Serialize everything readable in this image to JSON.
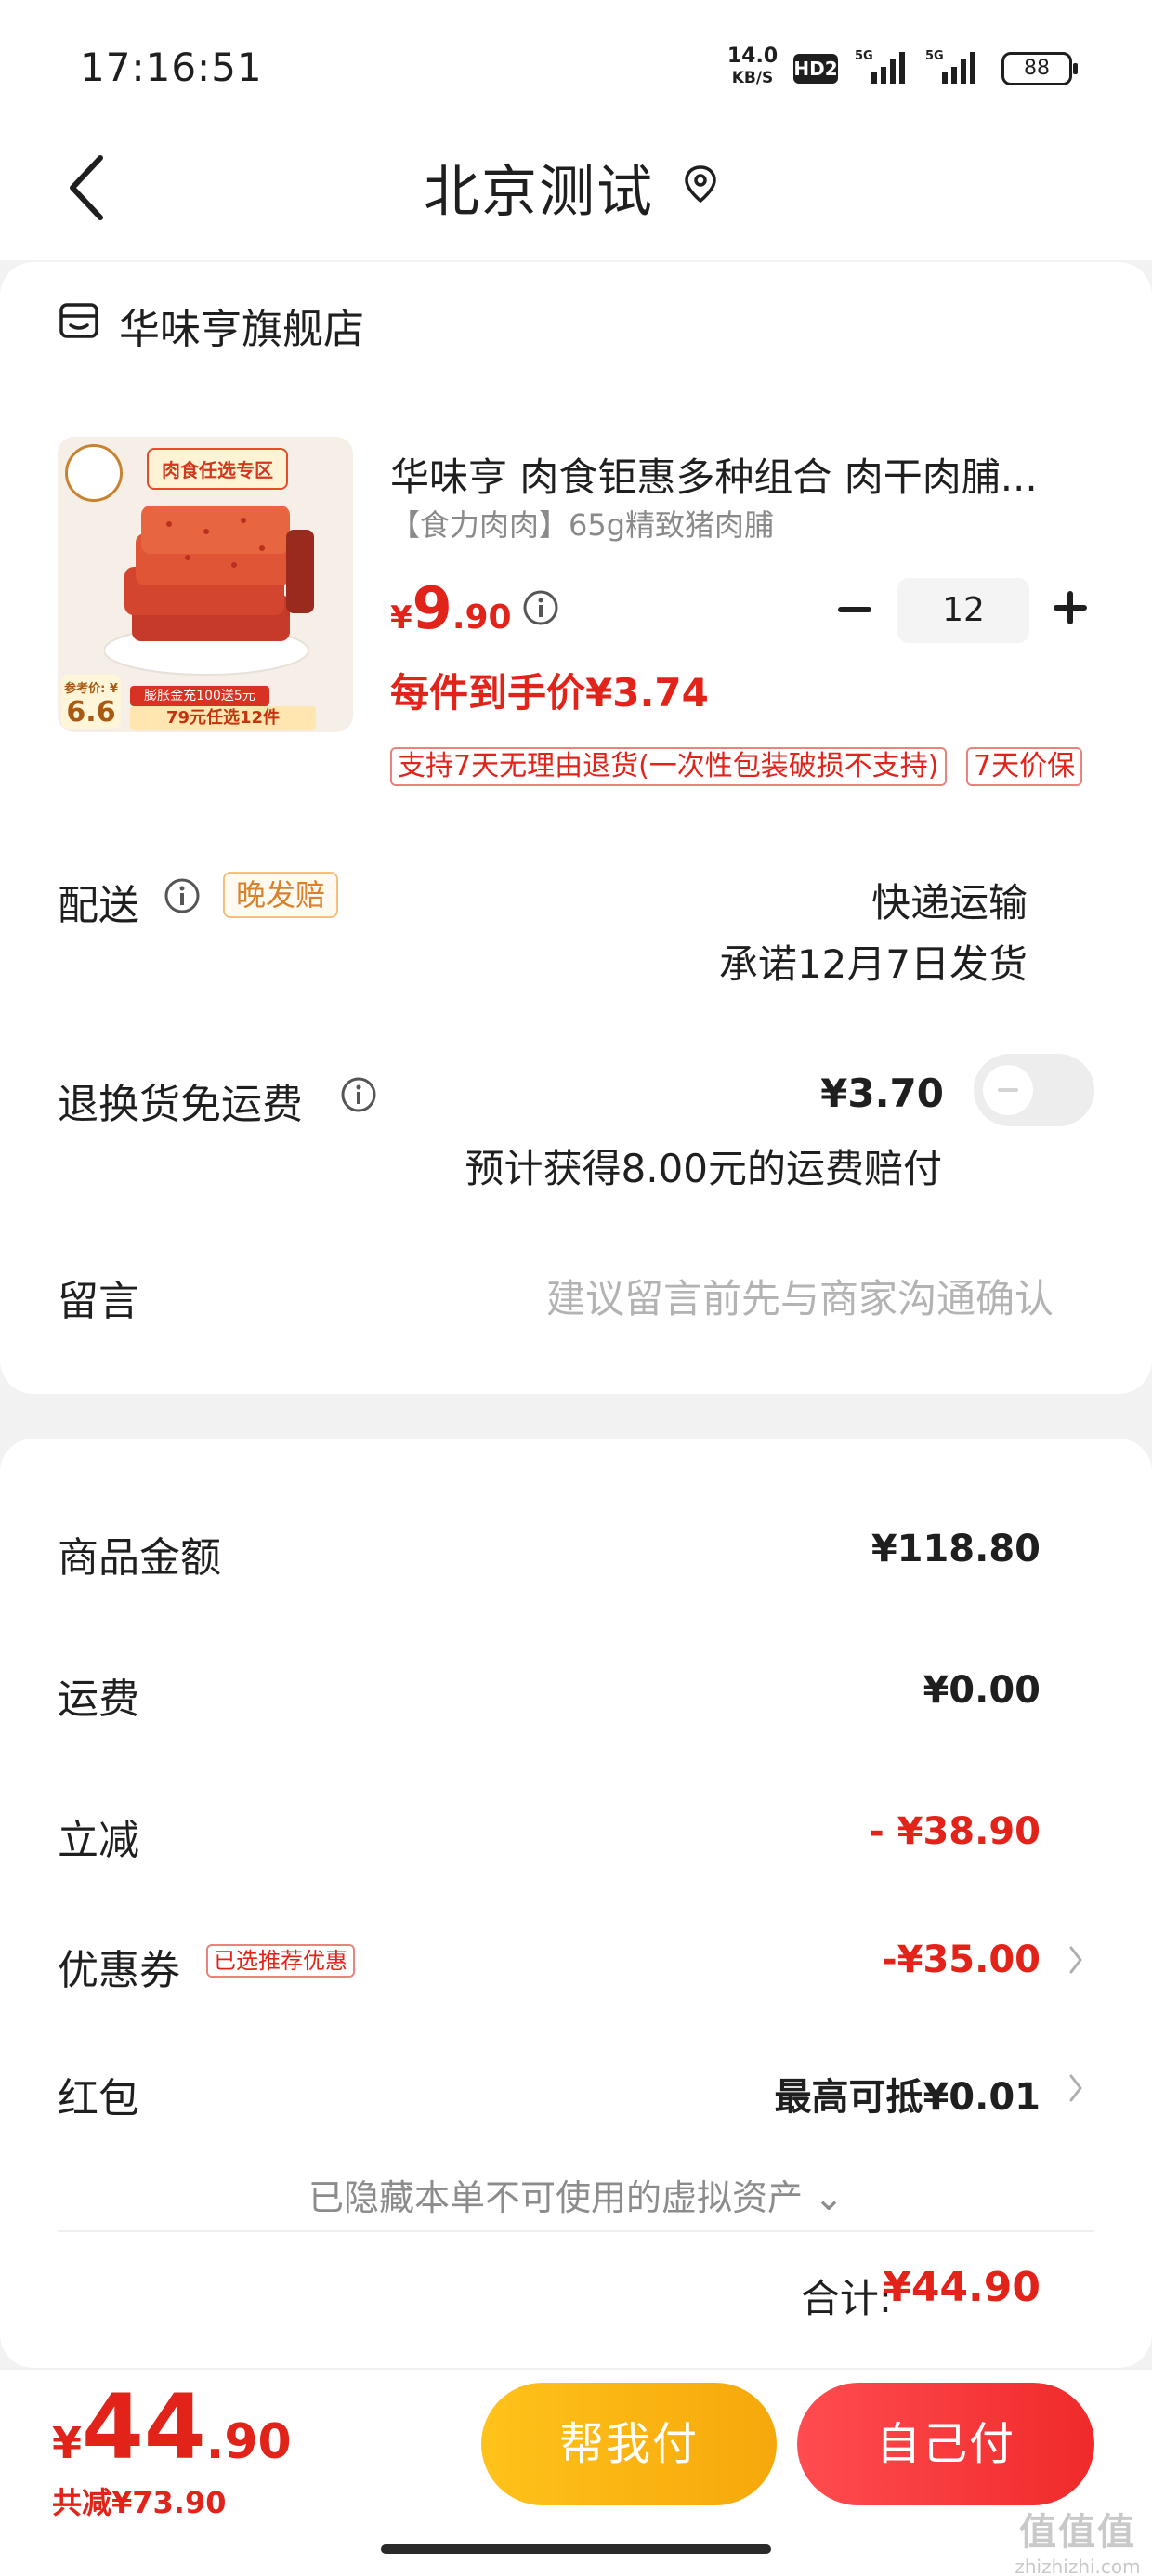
{
  "status_bar": {
    "time": "17:16:51",
    "net_speed": "14.0",
    "net_unit": "KB/S",
    "hd_badge": "HD2",
    "signal1_label": "5G",
    "signal2_label": "5G",
    "battery": "88"
  },
  "header": {
    "title": "北京测试"
  },
  "store": {
    "name": "华味亨旗舰店"
  },
  "product": {
    "image_tag": "肉食任选专区",
    "image_ref_label": "参考价: ¥",
    "image_ref_price": "6.6",
    "image_promo_1": "膨胀金充100送5元",
    "image_promo_2": "79元任选12件",
    "title": "华味亨 肉食钜惠多种组合 肉干肉脯...",
    "spec": "【食力肉肉】65g精致猪肉脯",
    "price_currency": "¥",
    "price_int": "9",
    "price_dec": ".90",
    "quantity": "12",
    "unit_price": "每件到手价¥3.74",
    "service_tags": [
      "支持7天无理由退货(一次性包装破损不支持)",
      "7天价保"
    ]
  },
  "delivery": {
    "label": "配送",
    "late_tag": "晚发赔",
    "method": "快递运输",
    "promise": "承诺12月7日发货"
  },
  "return_shipping": {
    "label": "退换货免运费",
    "price": "¥3.70",
    "note": "预计获得8.00元的运费赔付",
    "enabled": false
  },
  "message": {
    "label": "留言",
    "placeholder": "建议留言前先与商家沟通确认"
  },
  "summary": {
    "goods_label": "商品金额",
    "goods_value": "¥118.80",
    "shipping_label": "运费",
    "shipping_value": "¥0.00",
    "discount_label": "立减",
    "discount_value": "- ¥38.90",
    "coupon_label": "优惠券",
    "coupon_tag": "已选推荐优惠",
    "coupon_value": "-¥35.00",
    "redpacket_label": "红包",
    "redpacket_value": "最高可抵¥0.01",
    "hidden_note": "已隐藏本单不可使用的虚拟资产 ⌄",
    "total_label": "合计:",
    "total_value": "¥44.90"
  },
  "bottom_bar": {
    "price_currency": "¥",
    "price_int": "44",
    "price_dec": ".90",
    "saved": "共减¥73.90",
    "help_pay_label": "帮我付",
    "self_pay_label": "自己付"
  },
  "watermark": {
    "text": "值值值",
    "sub": "zhizhizhi.com"
  },
  "colors": {
    "accent_red": "#e2231a",
    "button_yellow": "#f6a80b",
    "button_red": "#f02a2a",
    "background": "#f2f2f2"
  }
}
